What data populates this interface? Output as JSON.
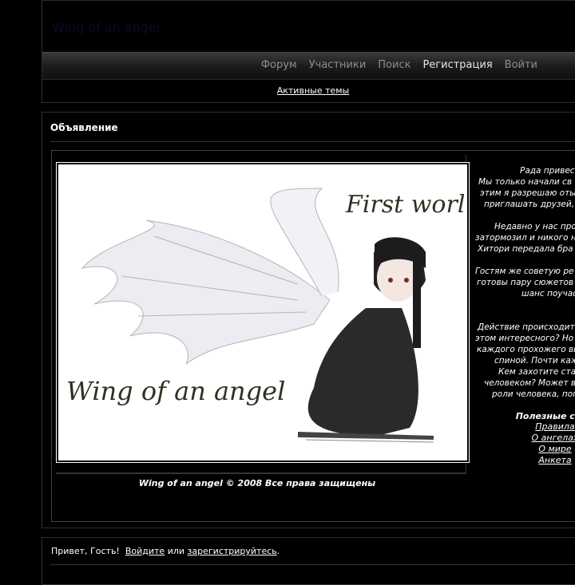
{
  "header": {
    "site_title": "Wing of an angel",
    "nav": [
      "Форум",
      "Участники",
      "Поиск",
      "Регистрация",
      "Войти"
    ],
    "active_nav": "Регистрация",
    "active_topics": "Активные темы"
  },
  "announcement": {
    "title": "Объявление",
    "banner": {
      "caption_top": "First world",
      "caption_bottom": "Wing of an angel"
    },
    "side_paragraphs": [
      [
        "Рада привест",
        "Мы только начали св",
        "этим я разрешаю оты",
        "приглашать друзей,"
      ],
      [
        "Недавно у нас про",
        "затормозил и никого н",
        "Хитори передала бра"
      ],
      [
        "Гостям же советую ре",
        "готовы пару сюжетов",
        "шанс поучас"
      ],
      [
        "Действие происходит",
        "этом интересного? Но",
        "каждого прохожего вы",
        "спиной. Почти каж",
        "Кем захотите стат",
        "человеком? Может в",
        "роли человека, поп"
      ]
    ],
    "useful_links_title": "Полезные ссыл",
    "useful_links": [
      "Правила",
      "О ангелах",
      "О мире",
      "Анкета"
    ],
    "copyright": "Wing of an angel © 2008 Все права защищены"
  },
  "greeting": {
    "prefix": "Привет, Гость!",
    "login": "Войдите",
    "or": "или",
    "register": "зарегистрируйтесь",
    "suffix": "."
  }
}
